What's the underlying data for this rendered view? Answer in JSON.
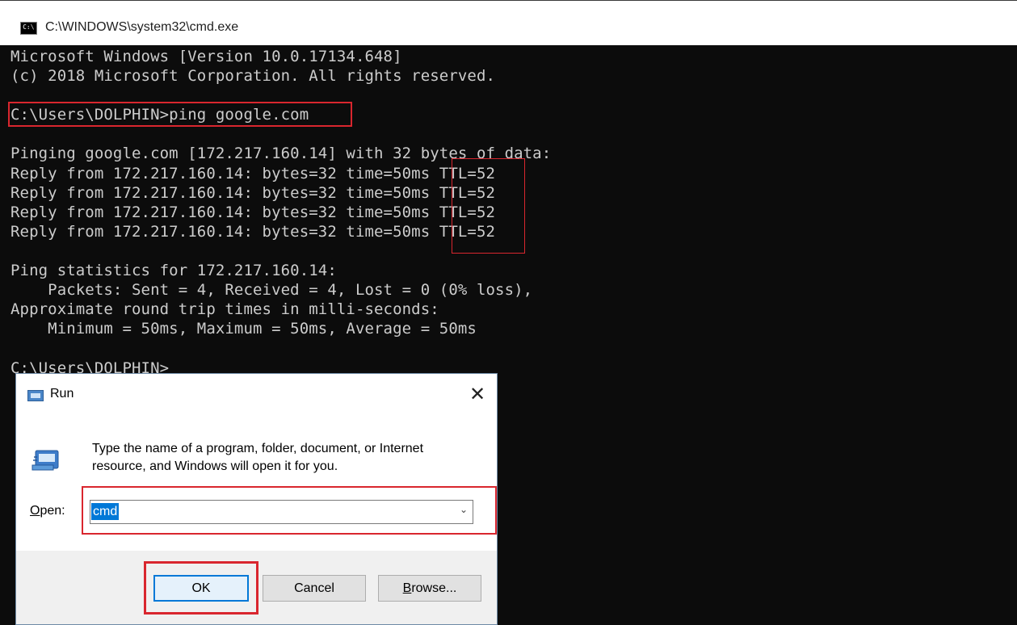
{
  "cmd": {
    "title": "C:\\WINDOWS\\system32\\cmd.exe",
    "lines": [
      "Microsoft Windows [Version 10.0.17134.648]",
      "(c) 2018 Microsoft Corporation. All rights reserved.",
      "",
      "C:\\Users\\DOLPHIN>ping google.com",
      "",
      "Pinging google.com [172.217.160.14] with 32 bytes of data:",
      "Reply from 172.217.160.14: bytes=32 time=50ms TTL=52",
      "Reply from 172.217.160.14: bytes=32 time=50ms TTL=52",
      "Reply from 172.217.160.14: bytes=32 time=50ms TTL=52",
      "Reply from 172.217.160.14: bytes=32 time=50ms TTL=52",
      "",
      "Ping statistics for 172.217.160.14:",
      "    Packets: Sent = 4, Received = 4, Lost = 0 (0% loss),",
      "Approximate round trip times in milli-seconds:",
      "    Minimum = 50ms, Maximum = 50ms, Average = 50ms",
      "",
      "C:\\Users\\DOLPHIN>"
    ]
  },
  "run_dialog": {
    "title": "Run",
    "close_glyph": "✕",
    "description": "Type the name of a program, folder, document, or Internet resource, and Windows will open it for you.",
    "open_label_accel": "O",
    "open_label_rest": "pen:",
    "open_value": "cmd",
    "dropdown_glyph": "⌄",
    "ok_label": "OK",
    "cancel_label": "Cancel",
    "browse_accel": "B",
    "browse_rest": "rowse..."
  },
  "colors": {
    "highlight": "#d9262e",
    "selection": "#0078d7",
    "console_bg": "#0c0c0c",
    "console_text": "#cccccc"
  }
}
